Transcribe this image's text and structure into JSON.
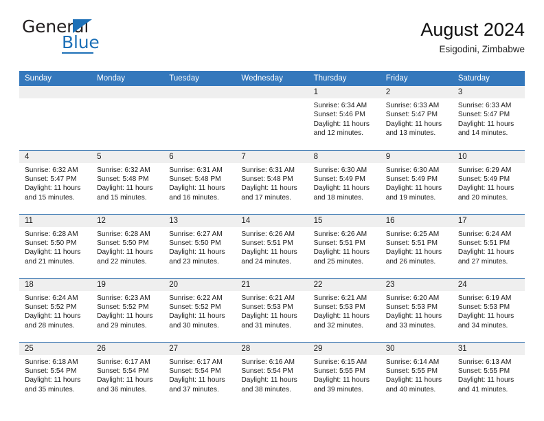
{
  "logo": {
    "word_one": "General",
    "word_two": "Blue",
    "triangle_color": "#1d70b7"
  },
  "header": {
    "title": "August 2024",
    "subtitle": "Esigodini, Zimbabwe"
  },
  "theme": {
    "header_bar_color": "#3478bc",
    "daynum_bg": "#efefef",
    "row_border": "#2f6fae",
    "text_color": "#1a1a1a",
    "page_bg": "#ffffff"
  },
  "calendar": {
    "columns": [
      "Sunday",
      "Monday",
      "Tuesday",
      "Wednesday",
      "Thursday",
      "Friday",
      "Saturday"
    ],
    "weeks": [
      [
        {
          "day": "",
          "blank": true
        },
        {
          "day": "",
          "blank": true
        },
        {
          "day": "",
          "blank": true
        },
        {
          "day": "",
          "blank": true
        },
        {
          "day": "1",
          "sunrise": "Sunrise: 6:34 AM",
          "sunset": "Sunset: 5:46 PM",
          "daylight_line1": "Daylight: 11 hours",
          "daylight_line2": "and 12 minutes."
        },
        {
          "day": "2",
          "sunrise": "Sunrise: 6:33 AM",
          "sunset": "Sunset: 5:47 PM",
          "daylight_line1": "Daylight: 11 hours",
          "daylight_line2": "and 13 minutes."
        },
        {
          "day": "3",
          "sunrise": "Sunrise: 6:33 AM",
          "sunset": "Sunset: 5:47 PM",
          "daylight_line1": "Daylight: 11 hours",
          "daylight_line2": "and 14 minutes."
        }
      ],
      [
        {
          "day": "4",
          "sunrise": "Sunrise: 6:32 AM",
          "sunset": "Sunset: 5:47 PM",
          "daylight_line1": "Daylight: 11 hours",
          "daylight_line2": "and 15 minutes."
        },
        {
          "day": "5",
          "sunrise": "Sunrise: 6:32 AM",
          "sunset": "Sunset: 5:48 PM",
          "daylight_line1": "Daylight: 11 hours",
          "daylight_line2": "and 15 minutes."
        },
        {
          "day": "6",
          "sunrise": "Sunrise: 6:31 AM",
          "sunset": "Sunset: 5:48 PM",
          "daylight_line1": "Daylight: 11 hours",
          "daylight_line2": "and 16 minutes."
        },
        {
          "day": "7",
          "sunrise": "Sunrise: 6:31 AM",
          "sunset": "Sunset: 5:48 PM",
          "daylight_line1": "Daylight: 11 hours",
          "daylight_line2": "and 17 minutes."
        },
        {
          "day": "8",
          "sunrise": "Sunrise: 6:30 AM",
          "sunset": "Sunset: 5:49 PM",
          "daylight_line1": "Daylight: 11 hours",
          "daylight_line2": "and 18 minutes."
        },
        {
          "day": "9",
          "sunrise": "Sunrise: 6:30 AM",
          "sunset": "Sunset: 5:49 PM",
          "daylight_line1": "Daylight: 11 hours",
          "daylight_line2": "and 19 minutes."
        },
        {
          "day": "10",
          "sunrise": "Sunrise: 6:29 AM",
          "sunset": "Sunset: 5:49 PM",
          "daylight_line1": "Daylight: 11 hours",
          "daylight_line2": "and 20 minutes."
        }
      ],
      [
        {
          "day": "11",
          "sunrise": "Sunrise: 6:28 AM",
          "sunset": "Sunset: 5:50 PM",
          "daylight_line1": "Daylight: 11 hours",
          "daylight_line2": "and 21 minutes."
        },
        {
          "day": "12",
          "sunrise": "Sunrise: 6:28 AM",
          "sunset": "Sunset: 5:50 PM",
          "daylight_line1": "Daylight: 11 hours",
          "daylight_line2": "and 22 minutes."
        },
        {
          "day": "13",
          "sunrise": "Sunrise: 6:27 AM",
          "sunset": "Sunset: 5:50 PM",
          "daylight_line1": "Daylight: 11 hours",
          "daylight_line2": "and 23 minutes."
        },
        {
          "day": "14",
          "sunrise": "Sunrise: 6:26 AM",
          "sunset": "Sunset: 5:51 PM",
          "daylight_line1": "Daylight: 11 hours",
          "daylight_line2": "and 24 minutes."
        },
        {
          "day": "15",
          "sunrise": "Sunrise: 6:26 AM",
          "sunset": "Sunset: 5:51 PM",
          "daylight_line1": "Daylight: 11 hours",
          "daylight_line2": "and 25 minutes."
        },
        {
          "day": "16",
          "sunrise": "Sunrise: 6:25 AM",
          "sunset": "Sunset: 5:51 PM",
          "daylight_line1": "Daylight: 11 hours",
          "daylight_line2": "and 26 minutes."
        },
        {
          "day": "17",
          "sunrise": "Sunrise: 6:24 AM",
          "sunset": "Sunset: 5:51 PM",
          "daylight_line1": "Daylight: 11 hours",
          "daylight_line2": "and 27 minutes."
        }
      ],
      [
        {
          "day": "18",
          "sunrise": "Sunrise: 6:24 AM",
          "sunset": "Sunset: 5:52 PM",
          "daylight_line1": "Daylight: 11 hours",
          "daylight_line2": "and 28 minutes."
        },
        {
          "day": "19",
          "sunrise": "Sunrise: 6:23 AM",
          "sunset": "Sunset: 5:52 PM",
          "daylight_line1": "Daylight: 11 hours",
          "daylight_line2": "and 29 minutes."
        },
        {
          "day": "20",
          "sunrise": "Sunrise: 6:22 AM",
          "sunset": "Sunset: 5:52 PM",
          "daylight_line1": "Daylight: 11 hours",
          "daylight_line2": "and 30 minutes."
        },
        {
          "day": "21",
          "sunrise": "Sunrise: 6:21 AM",
          "sunset": "Sunset: 5:53 PM",
          "daylight_line1": "Daylight: 11 hours",
          "daylight_line2": "and 31 minutes."
        },
        {
          "day": "22",
          "sunrise": "Sunrise: 6:21 AM",
          "sunset": "Sunset: 5:53 PM",
          "daylight_line1": "Daylight: 11 hours",
          "daylight_line2": "and 32 minutes."
        },
        {
          "day": "23",
          "sunrise": "Sunrise: 6:20 AM",
          "sunset": "Sunset: 5:53 PM",
          "daylight_line1": "Daylight: 11 hours",
          "daylight_line2": "and 33 minutes."
        },
        {
          "day": "24",
          "sunrise": "Sunrise: 6:19 AM",
          "sunset": "Sunset: 5:53 PM",
          "daylight_line1": "Daylight: 11 hours",
          "daylight_line2": "and 34 minutes."
        }
      ],
      [
        {
          "day": "25",
          "sunrise": "Sunrise: 6:18 AM",
          "sunset": "Sunset: 5:54 PM",
          "daylight_line1": "Daylight: 11 hours",
          "daylight_line2": "and 35 minutes."
        },
        {
          "day": "26",
          "sunrise": "Sunrise: 6:17 AM",
          "sunset": "Sunset: 5:54 PM",
          "daylight_line1": "Daylight: 11 hours",
          "daylight_line2": "and 36 minutes."
        },
        {
          "day": "27",
          "sunrise": "Sunrise: 6:17 AM",
          "sunset": "Sunset: 5:54 PM",
          "daylight_line1": "Daylight: 11 hours",
          "daylight_line2": "and 37 minutes."
        },
        {
          "day": "28",
          "sunrise": "Sunrise: 6:16 AM",
          "sunset": "Sunset: 5:54 PM",
          "daylight_line1": "Daylight: 11 hours",
          "daylight_line2": "and 38 minutes."
        },
        {
          "day": "29",
          "sunrise": "Sunrise: 6:15 AM",
          "sunset": "Sunset: 5:55 PM",
          "daylight_line1": "Daylight: 11 hours",
          "daylight_line2": "and 39 minutes."
        },
        {
          "day": "30",
          "sunrise": "Sunrise: 6:14 AM",
          "sunset": "Sunset: 5:55 PM",
          "daylight_line1": "Daylight: 11 hours",
          "daylight_line2": "and 40 minutes."
        },
        {
          "day": "31",
          "sunrise": "Sunrise: 6:13 AM",
          "sunset": "Sunset: 5:55 PM",
          "daylight_line1": "Daylight: 11 hours",
          "daylight_line2": "and 41 minutes."
        }
      ]
    ]
  }
}
